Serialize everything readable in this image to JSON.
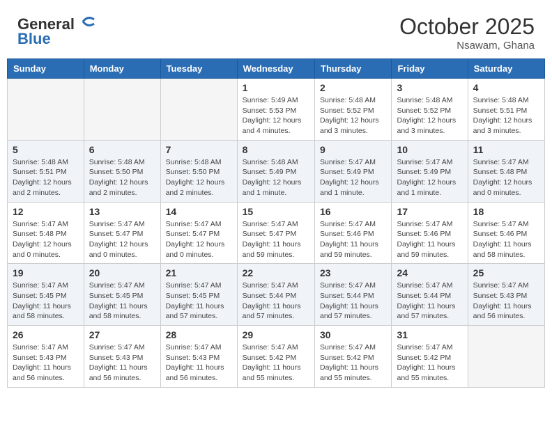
{
  "header": {
    "logo_line1": "General",
    "logo_line2": "Blue",
    "month_year": "October 2025",
    "location": "Nsawam, Ghana"
  },
  "days_of_week": [
    "Sunday",
    "Monday",
    "Tuesday",
    "Wednesday",
    "Thursday",
    "Friday",
    "Saturday"
  ],
  "weeks": [
    [
      {
        "day": "",
        "info": ""
      },
      {
        "day": "",
        "info": ""
      },
      {
        "day": "",
        "info": ""
      },
      {
        "day": "1",
        "info": "Sunrise: 5:49 AM\nSunset: 5:53 PM\nDaylight: 12 hours\nand 4 minutes."
      },
      {
        "day": "2",
        "info": "Sunrise: 5:48 AM\nSunset: 5:52 PM\nDaylight: 12 hours\nand 3 minutes."
      },
      {
        "day": "3",
        "info": "Sunrise: 5:48 AM\nSunset: 5:52 PM\nDaylight: 12 hours\nand 3 minutes."
      },
      {
        "day": "4",
        "info": "Sunrise: 5:48 AM\nSunset: 5:51 PM\nDaylight: 12 hours\nand 3 minutes."
      }
    ],
    [
      {
        "day": "5",
        "info": "Sunrise: 5:48 AM\nSunset: 5:51 PM\nDaylight: 12 hours\nand 2 minutes."
      },
      {
        "day": "6",
        "info": "Sunrise: 5:48 AM\nSunset: 5:50 PM\nDaylight: 12 hours\nand 2 minutes."
      },
      {
        "day": "7",
        "info": "Sunrise: 5:48 AM\nSunset: 5:50 PM\nDaylight: 12 hours\nand 2 minutes."
      },
      {
        "day": "8",
        "info": "Sunrise: 5:48 AM\nSunset: 5:49 PM\nDaylight: 12 hours\nand 1 minute."
      },
      {
        "day": "9",
        "info": "Sunrise: 5:47 AM\nSunset: 5:49 PM\nDaylight: 12 hours\nand 1 minute."
      },
      {
        "day": "10",
        "info": "Sunrise: 5:47 AM\nSunset: 5:49 PM\nDaylight: 12 hours\nand 1 minute."
      },
      {
        "day": "11",
        "info": "Sunrise: 5:47 AM\nSunset: 5:48 PM\nDaylight: 12 hours\nand 0 minutes."
      }
    ],
    [
      {
        "day": "12",
        "info": "Sunrise: 5:47 AM\nSunset: 5:48 PM\nDaylight: 12 hours\nand 0 minutes."
      },
      {
        "day": "13",
        "info": "Sunrise: 5:47 AM\nSunset: 5:47 PM\nDaylight: 12 hours\nand 0 minutes."
      },
      {
        "day": "14",
        "info": "Sunrise: 5:47 AM\nSunset: 5:47 PM\nDaylight: 12 hours\nand 0 minutes."
      },
      {
        "day": "15",
        "info": "Sunrise: 5:47 AM\nSunset: 5:47 PM\nDaylight: 11 hours\nand 59 minutes."
      },
      {
        "day": "16",
        "info": "Sunrise: 5:47 AM\nSunset: 5:46 PM\nDaylight: 11 hours\nand 59 minutes."
      },
      {
        "day": "17",
        "info": "Sunrise: 5:47 AM\nSunset: 5:46 PM\nDaylight: 11 hours\nand 59 minutes."
      },
      {
        "day": "18",
        "info": "Sunrise: 5:47 AM\nSunset: 5:46 PM\nDaylight: 11 hours\nand 58 minutes."
      }
    ],
    [
      {
        "day": "19",
        "info": "Sunrise: 5:47 AM\nSunset: 5:45 PM\nDaylight: 11 hours\nand 58 minutes."
      },
      {
        "day": "20",
        "info": "Sunrise: 5:47 AM\nSunset: 5:45 PM\nDaylight: 11 hours\nand 58 minutes."
      },
      {
        "day": "21",
        "info": "Sunrise: 5:47 AM\nSunset: 5:45 PM\nDaylight: 11 hours\nand 57 minutes."
      },
      {
        "day": "22",
        "info": "Sunrise: 5:47 AM\nSunset: 5:44 PM\nDaylight: 11 hours\nand 57 minutes."
      },
      {
        "day": "23",
        "info": "Sunrise: 5:47 AM\nSunset: 5:44 PM\nDaylight: 11 hours\nand 57 minutes."
      },
      {
        "day": "24",
        "info": "Sunrise: 5:47 AM\nSunset: 5:44 PM\nDaylight: 11 hours\nand 57 minutes."
      },
      {
        "day": "25",
        "info": "Sunrise: 5:47 AM\nSunset: 5:43 PM\nDaylight: 11 hours\nand 56 minutes."
      }
    ],
    [
      {
        "day": "26",
        "info": "Sunrise: 5:47 AM\nSunset: 5:43 PM\nDaylight: 11 hours\nand 56 minutes."
      },
      {
        "day": "27",
        "info": "Sunrise: 5:47 AM\nSunset: 5:43 PM\nDaylight: 11 hours\nand 56 minutes."
      },
      {
        "day": "28",
        "info": "Sunrise: 5:47 AM\nSunset: 5:43 PM\nDaylight: 11 hours\nand 56 minutes."
      },
      {
        "day": "29",
        "info": "Sunrise: 5:47 AM\nSunset: 5:42 PM\nDaylight: 11 hours\nand 55 minutes."
      },
      {
        "day": "30",
        "info": "Sunrise: 5:47 AM\nSunset: 5:42 PM\nDaylight: 11 hours\nand 55 minutes."
      },
      {
        "day": "31",
        "info": "Sunrise: 5:47 AM\nSunset: 5:42 PM\nDaylight: 11 hours\nand 55 minutes."
      },
      {
        "day": "",
        "info": ""
      }
    ]
  ]
}
